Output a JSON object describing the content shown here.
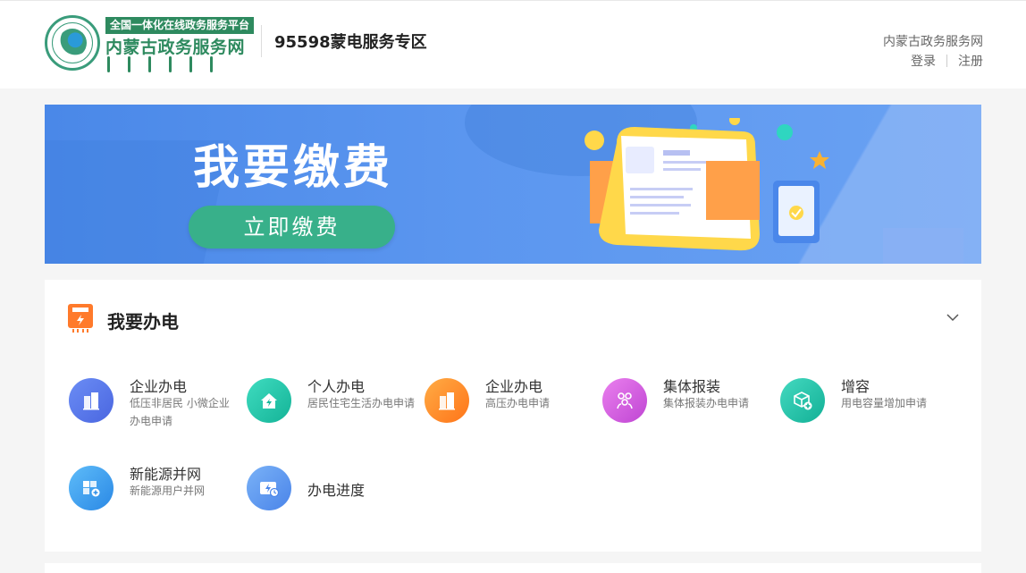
{
  "header": {
    "logo_tag": "全国一体化在线政务服务平台",
    "logo_name": "内蒙古政务服务网",
    "zone_title": "95598蒙电服务专区",
    "portal_link": "内蒙古政务服务网",
    "login": "登录",
    "register": "注册"
  },
  "banner": {
    "title": "我要缴费",
    "button": "立即缴费"
  },
  "section": {
    "title": "我要办电",
    "services": [
      {
        "name": "企业办电",
        "desc": "低压非居民 小微企业办电申请",
        "icon": "building-icon",
        "color1": "#5b7cf0",
        "color2": "#4a66e0"
      },
      {
        "name": "个人办电",
        "desc": "居民住宅生活办电申请",
        "icon": "home-icon",
        "color1": "#2fd0b3",
        "color2": "#16b69a"
      },
      {
        "name": "企业办电",
        "desc": "高压办电申请",
        "icon": "building-icon",
        "color1": "#ffa23a",
        "color2": "#ff7b1c"
      },
      {
        "name": "集体报装",
        "desc": "集体报装办电申请",
        "icon": "group-icon",
        "color1": "#e070e8",
        "color2": "#c24bd6"
      },
      {
        "name": "增容",
        "desc": "用电容量增加申请",
        "icon": "box-plus-icon",
        "color1": "#36cfb6",
        "color2": "#17b399"
      },
      {
        "name": "新能源并网",
        "desc": "新能源用户并网",
        "icon": "solar-panel-icon",
        "color1": "#4fb0f7",
        "color2": "#2c8de8"
      },
      {
        "name": "办电进度",
        "desc": "",
        "icon": "progress-icon",
        "color1": "#6aa5f5",
        "color2": "#4a86ea"
      }
    ]
  }
}
